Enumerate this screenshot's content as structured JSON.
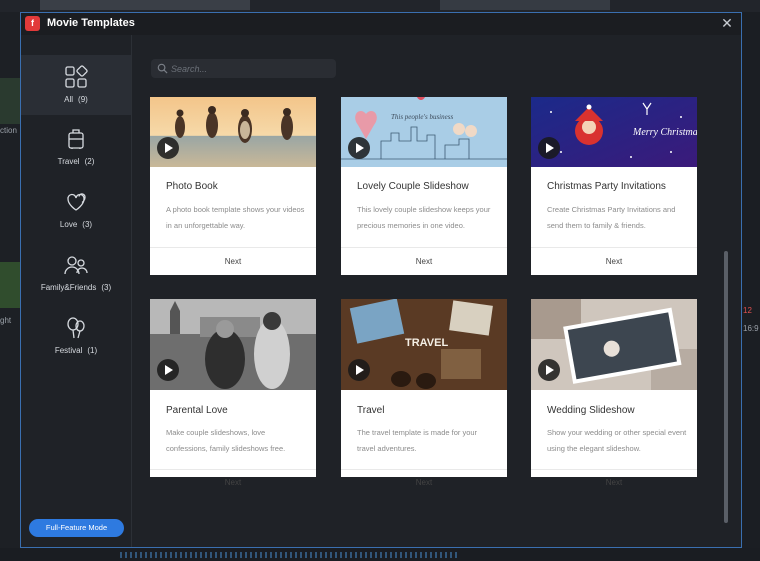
{
  "dialog": {
    "title": "Movie Templates",
    "close_glyph": "✕",
    "app_icon": "app-logo-icon"
  },
  "background": {
    "left_texts": [
      "ction",
      "ght"
    ],
    "right_texts": [
      "12",
      "16:9"
    ]
  },
  "sidebar": {
    "items": [
      {
        "label": "All",
        "count": "(9)",
        "icon": "grid-icon",
        "active": true
      },
      {
        "label": "Travel",
        "count": "(2)",
        "icon": "suitcase-icon",
        "active": false
      },
      {
        "label": "Love",
        "count": "(3)",
        "icon": "hearts-icon",
        "active": false
      },
      {
        "label": "Family&Friends",
        "count": "(3)",
        "icon": "people-icon",
        "active": false
      },
      {
        "label": "Festival",
        "count": "(1)",
        "icon": "balloons-icon",
        "active": false
      }
    ],
    "full_feature_label": "Full-Feature Mode"
  },
  "search": {
    "placeholder": "Search...",
    "value": ""
  },
  "templates": [
    {
      "title": "Photo Book",
      "description": "A photo book template shows your videos in an unforgettable way.",
      "next_label": "Next",
      "thumb_text": ""
    },
    {
      "title": "Lovely Couple Slideshow",
      "description": "This lovely couple slideshow keeps your precious memories in one video.",
      "next_label": "Next",
      "thumb_text": "This people's business"
    },
    {
      "title": "Christmas Party Invitations",
      "description": "Create Christmas Party Invitations and send them to family & friends.",
      "next_label": "Next",
      "thumb_text": "Merry Christmas"
    },
    {
      "title": "Parental Love",
      "description": "Make couple slideshows, love confessions, family slideshows free.",
      "next_label": "Next",
      "thumb_text": ""
    },
    {
      "title": "Travel",
      "description": "The travel template is made for your travel adventures.",
      "next_label": "Next",
      "thumb_text": "TRAVEL"
    },
    {
      "title": "Wedding Slideshow",
      "description": "Show your wedding or other special event using the elegant slideshow.",
      "next_label": "Next",
      "thumb_text": ""
    }
  ],
  "colors": {
    "accent": "#2e7ae0",
    "dialog_border": "#3a6fb0",
    "dialog_bg": "#1f2227"
  }
}
